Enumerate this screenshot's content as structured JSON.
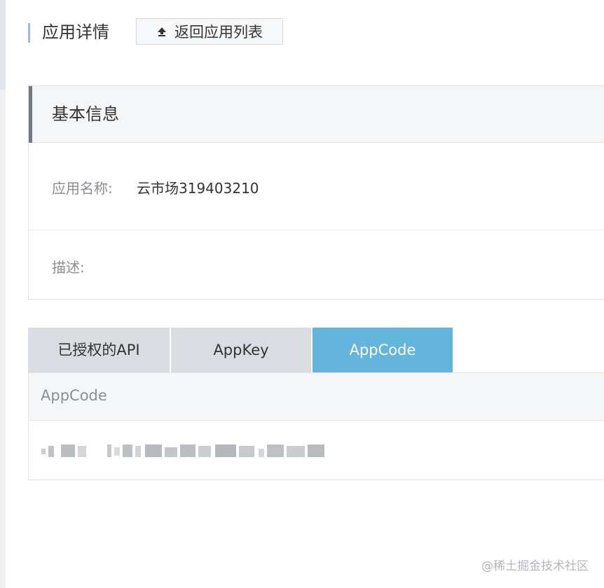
{
  "header": {
    "title": "应用详情",
    "back_button_label": "返回应用列表"
  },
  "basic_info": {
    "title": "基本信息",
    "fields": [
      {
        "label": "应用名称:",
        "value": "云市场319403210"
      },
      {
        "label": "描述:",
        "value": ""
      }
    ]
  },
  "tabs": [
    {
      "label": "已授权的API",
      "active": false
    },
    {
      "label": "AppKey",
      "active": false
    },
    {
      "label": "AppCode",
      "active": true
    }
  ],
  "appcode_panel": {
    "column_header": "AppCode"
  },
  "watermark": "@稀土掘金技术社区",
  "colors": {
    "active_tab": "#64b5dc",
    "inactive_tab": "#d9dde2",
    "header_accent": "#9fb8da",
    "section_accent": "#737882"
  },
  "icons": {
    "back_button": "upload-icon"
  }
}
